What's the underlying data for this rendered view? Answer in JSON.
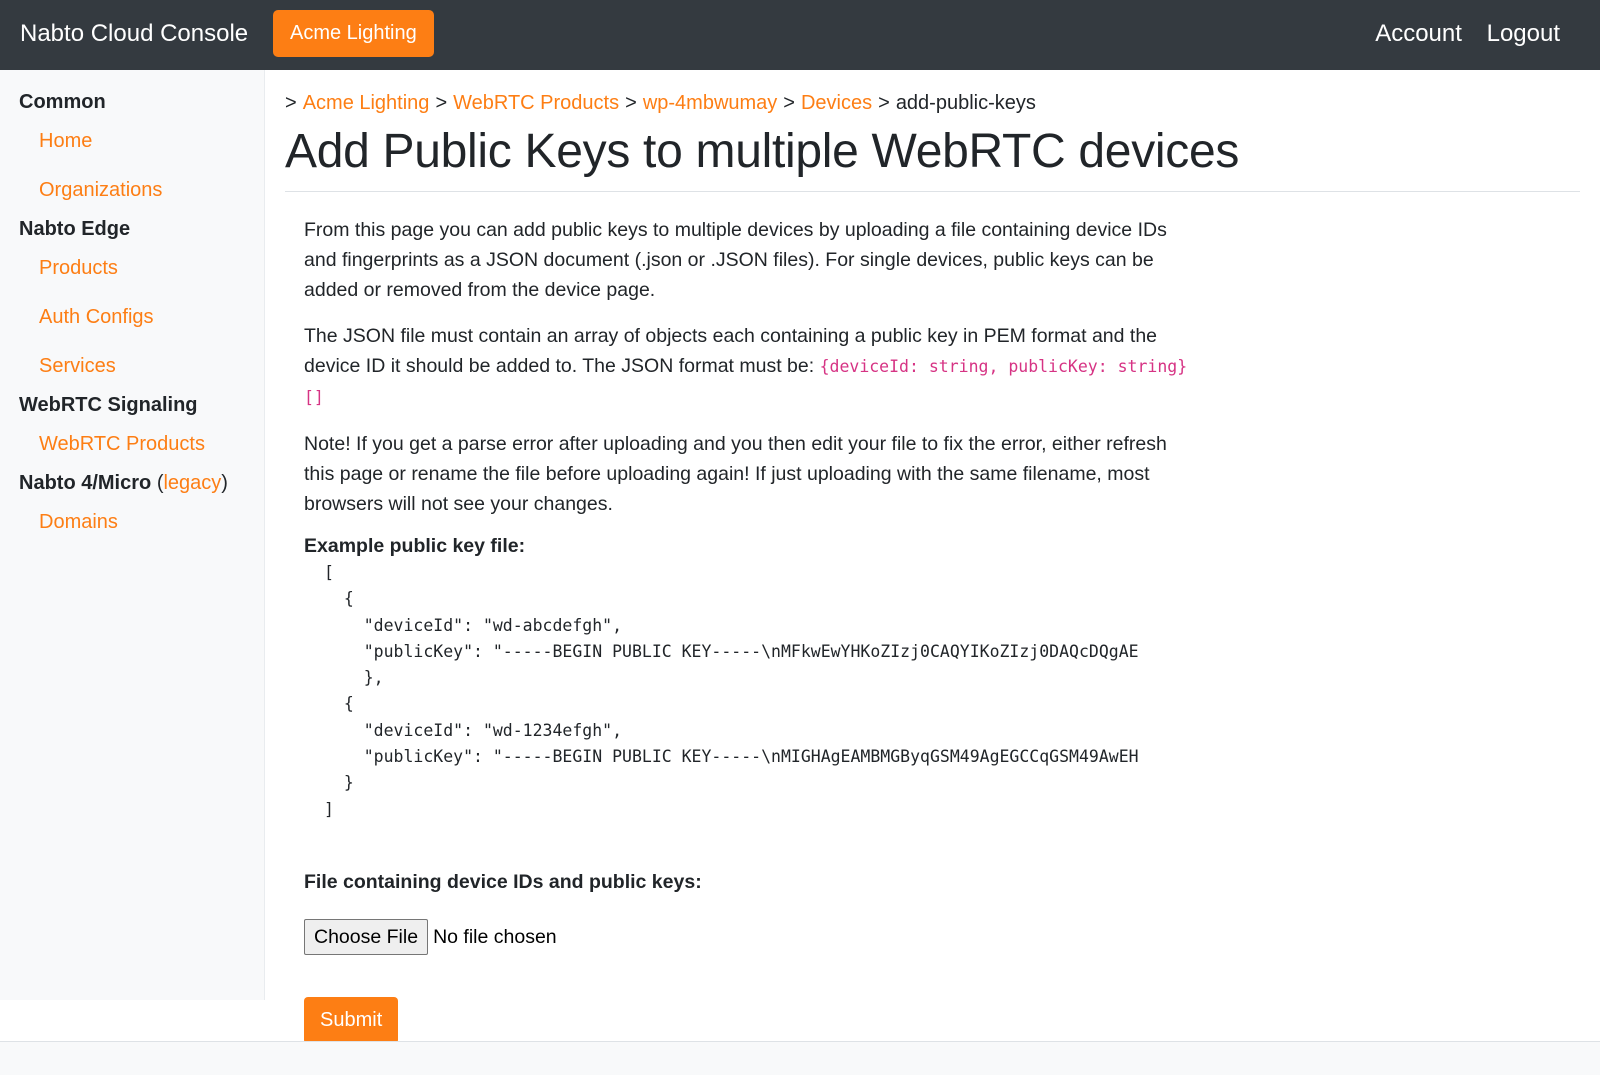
{
  "topbar": {
    "brand": "Nabto Cloud Console",
    "org_button": "Acme Lighting",
    "account": "Account",
    "logout": "Logout"
  },
  "sidebar": {
    "common": "Common",
    "home": "Home",
    "organizations": "Organizations",
    "nabto_edge": "Nabto Edge",
    "products": "Products",
    "auth_configs": "Auth Configs",
    "services": "Services",
    "webrtc_signaling": "WebRTC Signaling",
    "webrtc_products": "WebRTC Products",
    "nabto4_micro": "Nabto 4/Micro",
    "paren_open": "(",
    "legacy": "legacy",
    "paren_close": ")",
    "domains": "Domains"
  },
  "breadcrumb": {
    "sep": ">",
    "items": [
      "Acme Lighting",
      "WebRTC Products",
      "wp-4mbwumay",
      "Devices"
    ],
    "current": "add-public-keys"
  },
  "page": {
    "title": "Add Public Keys to multiple WebRTC devices",
    "para1": "From this page you can add public keys to multiple devices by uploading a file containing device IDs and fingerprints as a JSON document (.json or .JSON files). For single devices, public keys can be added or removed from the device page.",
    "para2_text": "The JSON file must contain an array of objects each containing a public key in PEM format and the device ID it should be added to. The JSON format must be: ",
    "para2_code": "{deviceId: string, publicKey: string}[]",
    "para3": "Note! If you get a parse error after uploading and you then edit your file to fix the error, either refresh this page or rename the file before uploading again! If just uploading with the same filename, most browsers will not see your changes.",
    "example_label": "Example public key file:",
    "example_code": "[\n  {\n    \"deviceId\": \"wd-abcdefgh\",\n    \"publicKey\": \"-----BEGIN PUBLIC KEY-----\\nMFkwEwYHKoZIzj0CAQYIKoZIzj0DAQcDQgAE\n    },\n  {\n    \"deviceId\": \"wd-1234efgh\",\n    \"publicKey\": \"-----BEGIN PUBLIC KEY-----\\nMIGHAgEAMBMGByqGSM49AgEGCCqGSM49AwEH\n  }\n]",
    "file_label": "File containing device IDs and public keys:",
    "choose_file": "Choose File",
    "no_file": "No file chosen",
    "submit": "Submit"
  }
}
